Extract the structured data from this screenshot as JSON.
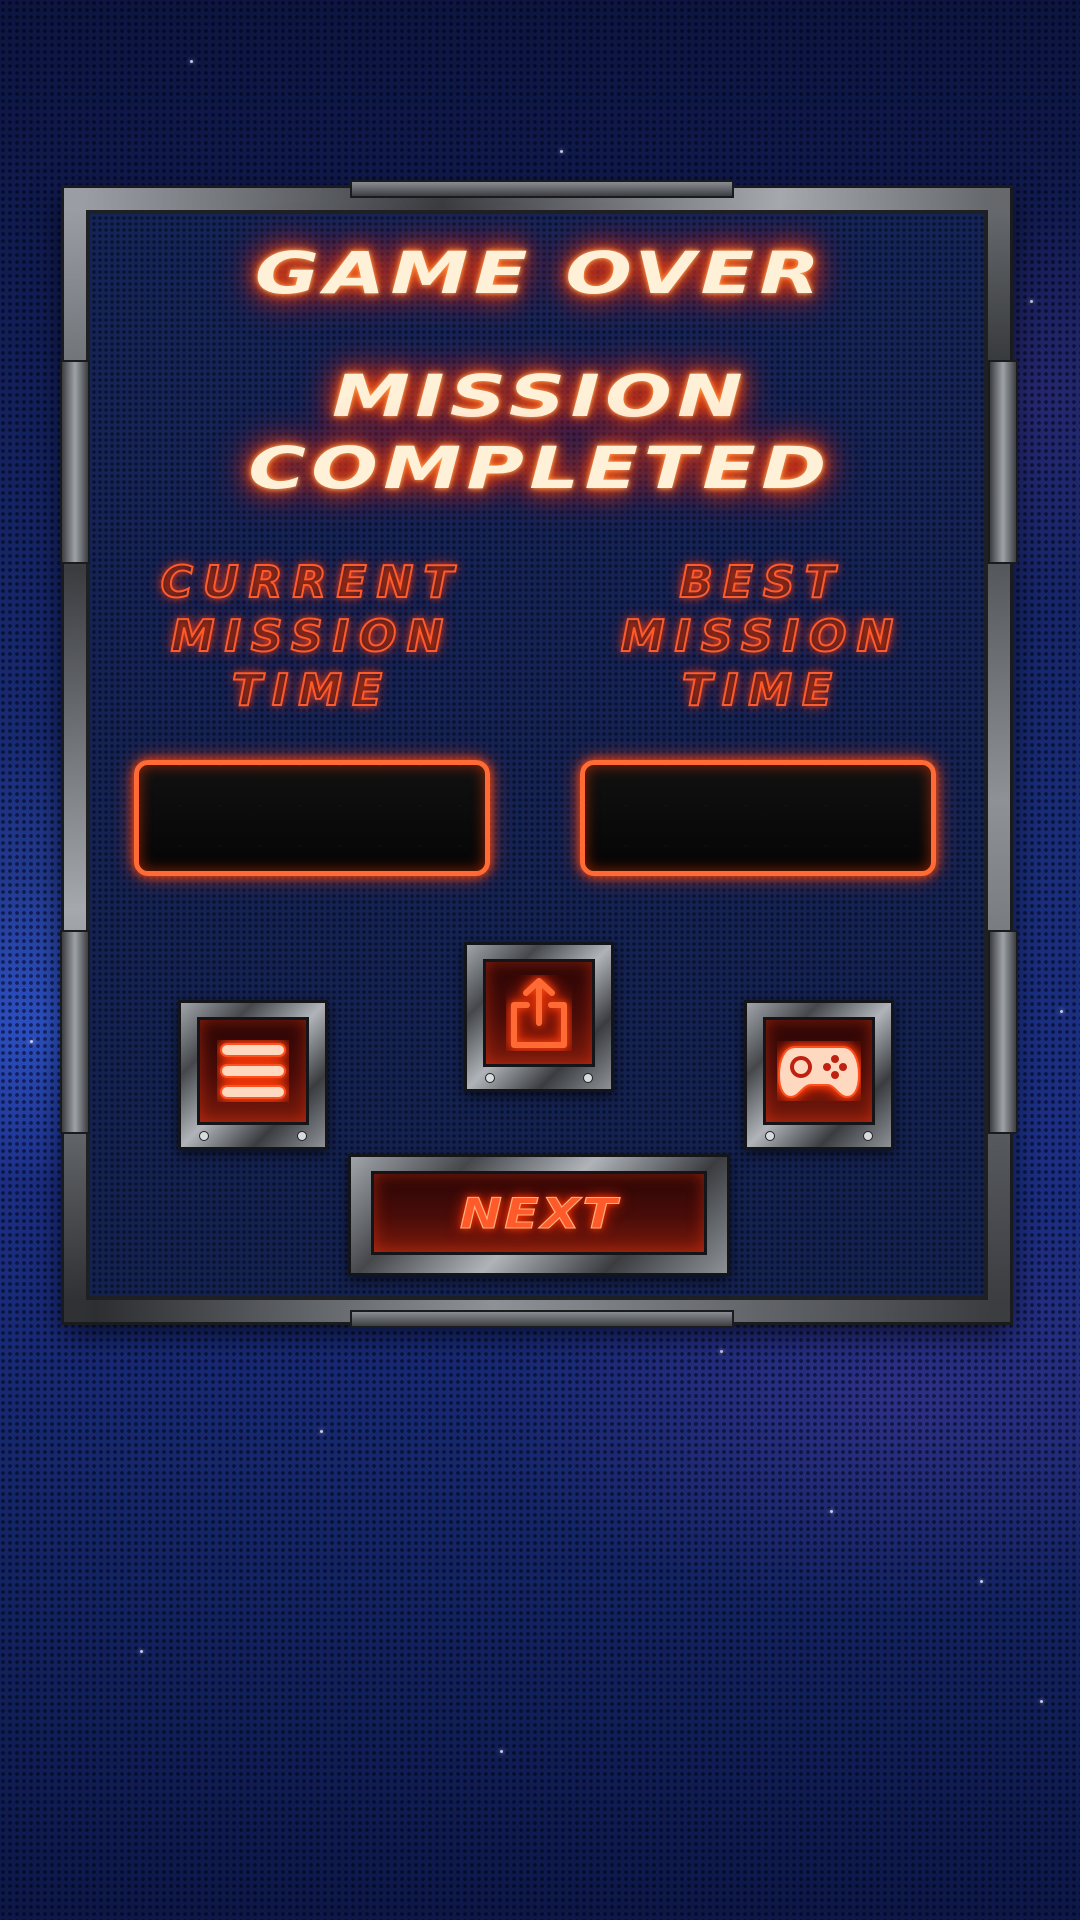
{
  "screen": {
    "title_line1": "GAME OVER",
    "title_line2": "MISSION",
    "title_line3": "COMPLETED"
  },
  "stats": {
    "current": {
      "label": "CURRENT\nMISSION\nTIME",
      "value": ""
    },
    "best": {
      "label": "BEST\nMISSION\nTIME",
      "value": ""
    }
  },
  "buttons": {
    "menu": {
      "icon": "menu-icon"
    },
    "share": {
      "icon": "share-icon"
    },
    "games": {
      "icon": "gamepad-icon"
    },
    "next": {
      "label": "NEXT"
    }
  },
  "colors": {
    "glow": "#ff4a10",
    "title_text": "#fff0d8",
    "background": "#1a2e7a"
  }
}
